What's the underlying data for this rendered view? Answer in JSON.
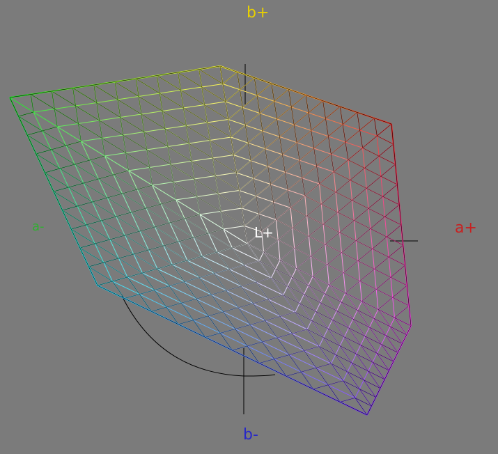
{
  "viewer": {
    "labels": {
      "b_plus": "b+",
      "b_minus": "b-",
      "a_minus": "a-",
      "a_plus": "a+",
      "l_plus": "L+"
    },
    "colors": {
      "background": "#7b7b7b",
      "b_plus": "#e8d000",
      "b_minus": "#2828c8",
      "a_minus": "#2fb02f",
      "a_plus": "#c82020",
      "l_plus": "#ffffff",
      "mesh_outline": "#000000"
    },
    "hull_vertex_colors": [
      "green",
      "yellow",
      "orange",
      "red",
      "magenta",
      "violet",
      "blue",
      "cyan"
    ],
    "icons": [
      "axis-cross",
      "gamut-mesh"
    ]
  }
}
